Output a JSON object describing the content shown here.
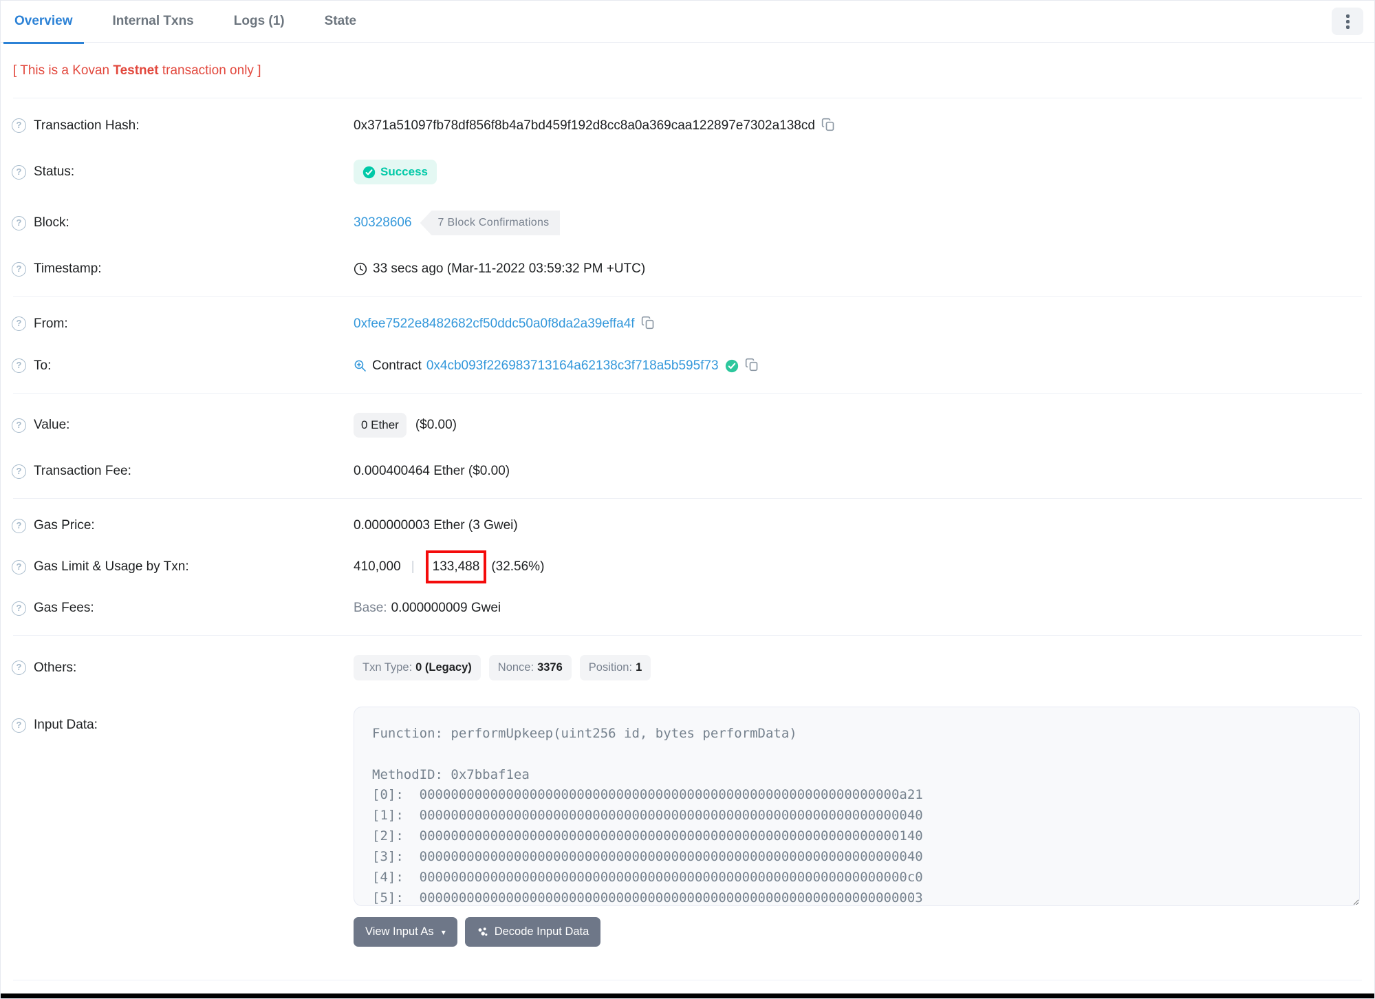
{
  "tabs": [
    {
      "label": "Overview",
      "active": true
    },
    {
      "label": "Internal Txns",
      "active": false
    },
    {
      "label": "Logs (1)",
      "active": false
    },
    {
      "label": "State",
      "active": false
    }
  ],
  "notice": {
    "prefix": "[ This is a Kovan ",
    "bold": "Testnet",
    "suffix": " transaction only ]"
  },
  "rows": {
    "transaction_hash": {
      "label": "Transaction Hash:",
      "value": "0x371a51097fb78df856f8b4a7bd459f192d8cc8a0a369caa122897e7302a138cd"
    },
    "status": {
      "label": "Status:",
      "value": "Success"
    },
    "block": {
      "label": "Block:",
      "number": "30328606",
      "confirmations": "7 Block Confirmations"
    },
    "timestamp": {
      "label": "Timestamp:",
      "value": "33 secs ago (Mar-11-2022 03:59:32 PM +UTC)"
    },
    "from": {
      "label": "From:",
      "address": "0xfee7522e8482682cf50ddc50a0f8da2a39effa4f"
    },
    "to": {
      "label": "To:",
      "contract_word": "Contract",
      "address": "0x4cb093f226983713164a62138c3f718a5b595f73"
    },
    "value": {
      "label": "Value:",
      "badge": "0 Ether",
      "usd": "($0.00)"
    },
    "txn_fee": {
      "label": "Transaction Fee:",
      "value": "0.000400464 Ether ($0.00)"
    },
    "gas_price": {
      "label": "Gas Price:",
      "value": "0.000000003 Ether (3 Gwei)"
    },
    "gas_limit": {
      "label": "Gas Limit & Usage by Txn:",
      "limit": "410,000",
      "separator": "|",
      "used": "133,488",
      "percent": "(32.56%)"
    },
    "gas_fees": {
      "label": "Gas Fees:",
      "base_label": "Base:",
      "base_value": "0.000000009 Gwei"
    },
    "others": {
      "label": "Others:",
      "badges": [
        {
          "k": "Txn Type:",
          "v": "0 (Legacy)"
        },
        {
          "k": "Nonce:",
          "v": "3376"
        },
        {
          "k": "Position:",
          "v": "1"
        }
      ]
    },
    "input_data": {
      "label": "Input Data:",
      "content": "Function: performUpkeep(uint256 id, bytes performData)\n\nMethodID: 0x7bbaf1ea\n[0]:  0000000000000000000000000000000000000000000000000000000000000a21\n[1]:  0000000000000000000000000000000000000000000000000000000000000040\n[2]:  0000000000000000000000000000000000000000000000000000000000000140\n[3]:  0000000000000000000000000000000000000000000000000000000000000040\n[4]:  00000000000000000000000000000000000000000000000000000000000000c0\n[5]:  0000000000000000000000000000000000000000000000000000000000000003"
    }
  },
  "buttons": {
    "view_input_as": "View Input As",
    "decode": "Decode Input Data"
  },
  "colors": {
    "link_blue": "#3498db",
    "success_green": "#00c9a7",
    "notice_red": "#e2483d",
    "annotation_red": "#f40b0b"
  }
}
